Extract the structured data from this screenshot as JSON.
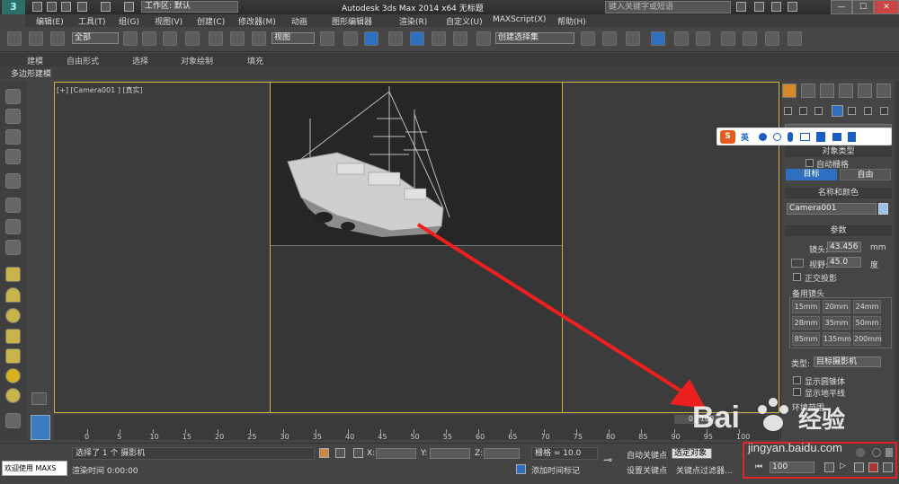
{
  "titlebar": {
    "workspace": "工作区: 默认",
    "title": "Autodesk 3ds Max  2014 x64      无标题",
    "search_placeholder": "键入关键字或短语",
    "minimize": "—",
    "maximize": "☐",
    "close": "✕"
  },
  "menubar": [
    "编辑(E)",
    "工具(T)",
    "组(G)",
    "视图(V)",
    "创建(C)",
    "修改器(M)",
    "动画",
    "图形编辑器",
    "渲染(R)",
    "自定义(U)",
    "MAXScript(X)",
    "帮助(H)"
  ],
  "toolbar": {
    "selection_filter": "全部",
    "ref_coord": "视图",
    "named_selection": "创建选择集"
  },
  "ribbon": {
    "tabs": [
      "建模",
      "自由形式",
      "选择",
      "对象绘制",
      "填充"
    ],
    "sub_label": "多边形建模"
  },
  "viewport": {
    "label": "[+] [Camera001 ] [真实]"
  },
  "command_panel": {
    "object_type_header": "对象类型",
    "autogrid": "自动栅格",
    "target_btn": "目标",
    "free_btn": "自由",
    "name_color_header": "名称和颜色",
    "camera_name": "Camera001",
    "params_header": "参数",
    "lens_label": "镜头:",
    "lens_value": "43.456",
    "lens_unit": "mm",
    "fov_label": "视野:",
    "fov_value": "45.0",
    "fov_unit": "度",
    "ortho": "正交投影",
    "stock_lens": "备用镜头",
    "lens_buttons": [
      "15mm",
      "20mm",
      "24mm",
      "28mm",
      "35mm",
      "50mm",
      "85mm",
      "135mm",
      "200mm"
    ],
    "type_label": "类型:",
    "type_value": "目标摄影机",
    "show_cone": "显示圆锥体",
    "show_horizon": "显示地平线",
    "env_range": "环境范围"
  },
  "timeline": {
    "ticks": [
      "0",
      "5",
      "10",
      "15",
      "20",
      "25",
      "30",
      "35",
      "40",
      "45",
      "50",
      "55",
      "60",
      "65",
      "70",
      "75",
      "80",
      "85",
      "90",
      "95",
      "100"
    ],
    "frame": "0 / 100"
  },
  "status": {
    "welcome": "欢迎使用 MAXS",
    "selected": "选择了 1 个 摄影机",
    "render_time": "渲染时间  0:00:00",
    "x_label": "X:",
    "y_label": "Y:",
    "z_label": "Z:",
    "grid": "栅格 = 10.0",
    "add_time_tag": "添加时间标记",
    "auto_key": "自动关键点",
    "selected_obj": "选定对象",
    "set_key": "设置关键点",
    "key_filter": "关键点过滤器...",
    "frame_field": "100"
  },
  "watermark": {
    "brand": "Bai",
    "brand2": "经验",
    "url": "jingyan.baidu.com"
  },
  "ime": {
    "mode": "英"
  },
  "colors": {
    "viewport_border": "#c9b44a",
    "highlight_red": "#e2232a",
    "button_active": "#2f6fbf"
  }
}
